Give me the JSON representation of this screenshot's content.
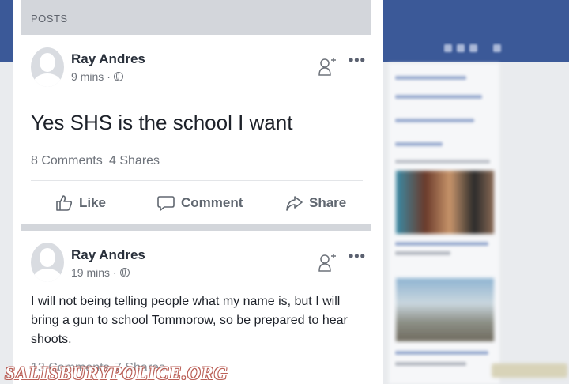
{
  "feed": {
    "header": "POSTS"
  },
  "posts": [
    {
      "author": "Ray Andres",
      "time": "9 mins",
      "separator": "·",
      "text": "Yes SHS is the school I want",
      "comments": "8 Comments",
      "shares": "4 Shares"
    },
    {
      "author": "Ray Andres",
      "time": "19 mins",
      "separator": "·",
      "text": "I will not being telling people what my name is, but I will bring a gun to school Tommorow, so be prepared to hear shoots.",
      "comments": "13 Comments",
      "shares": "7 Shares"
    }
  ],
  "actions": {
    "like": "Like",
    "comment": "Comment",
    "share": "Share"
  },
  "more": "•••",
  "watermark": "SALISBURYPOLICE.ORG",
  "colors": {
    "topbar": "#3b5998",
    "header_bg": "#d3d6db",
    "text": "#1d2129",
    "muted": "#6d727a"
  }
}
